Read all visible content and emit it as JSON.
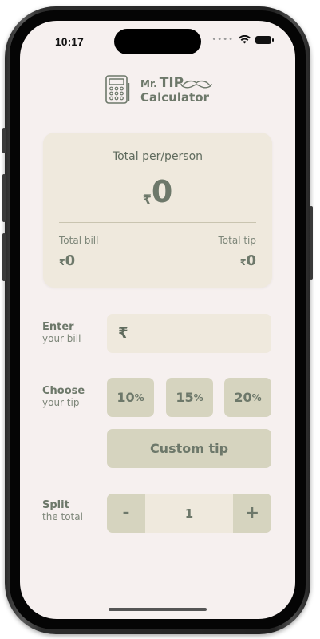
{
  "status": {
    "time": "10:17"
  },
  "logo": {
    "mr": "Mr.",
    "tip": "TIP",
    "calculator": "Calculator"
  },
  "summary": {
    "title": "Total per/person",
    "currency": "₹",
    "per_person": "0",
    "bill_label": "Total bill",
    "bill_value": "0",
    "tip_label": "Total tip",
    "tip_value": "0"
  },
  "bill": {
    "title": "Enter",
    "subtitle": "your bill",
    "currency": "₹",
    "value": ""
  },
  "tip": {
    "title": "Choose",
    "subtitle": "your tip",
    "options": [
      {
        "num": "10",
        "pct": "%"
      },
      {
        "num": "15",
        "pct": "%"
      },
      {
        "num": "20",
        "pct": "%"
      }
    ],
    "custom_label": "Custom tip"
  },
  "split": {
    "title": "Split",
    "subtitle": "the total",
    "minus": "-",
    "count": "1",
    "plus": "+"
  },
  "colors": {
    "background": "#f6f0ef",
    "card": "#efe9dd",
    "button": "#d6d4bf",
    "accent": "#6d786a"
  }
}
